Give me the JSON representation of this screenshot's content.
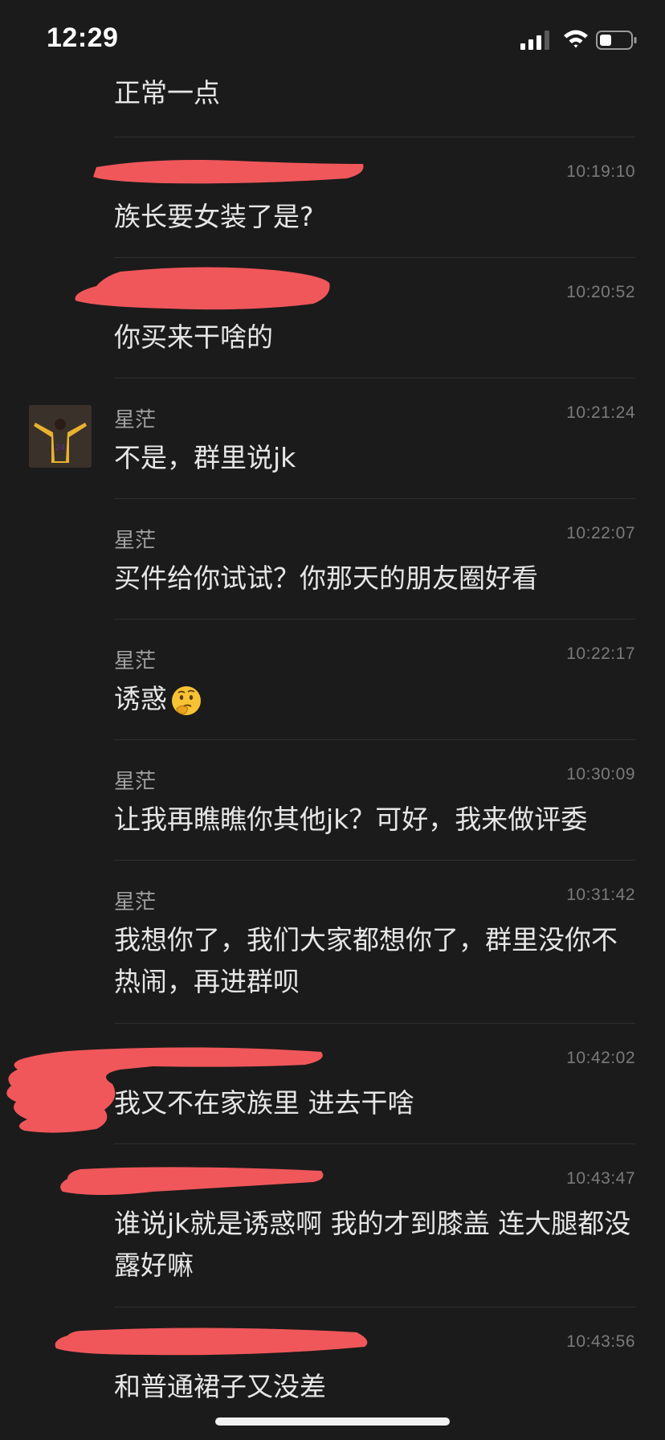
{
  "status_bar": {
    "time": "12:29",
    "signal_icon": "cellular-signal-icon",
    "wifi_icon": "wifi-icon",
    "battery_icon": "battery-icon"
  },
  "messages": [
    {
      "sender": "",
      "time": "",
      "text": "正常一点"
    },
    {
      "sender": "",
      "time": "10:19:10",
      "text": "族长要女装了是?"
    },
    {
      "sender": "",
      "time": "10:20:52",
      "text": "你买来干啥的"
    },
    {
      "sender": "星茫",
      "time": "10:21:24",
      "text": "不是，群里说jk"
    },
    {
      "sender": "星茫",
      "time": "10:22:07",
      "text": "买件给你试试？你那天的朋友圈好看"
    },
    {
      "sender": "星茫",
      "time": "10:22:17",
      "text": "诱惑"
    },
    {
      "sender": "星茫",
      "time": "10:30:09",
      "text": "让我再瞧瞧你其他jk？可好，我来做评委"
    },
    {
      "sender": "星茫",
      "time": "10:31:42",
      "text": "我想你了，我们大家都想你了，群里没你不热闹，再进群呗"
    },
    {
      "sender": "",
      "time": "10:42:02",
      "text": "我又不在家族里 进去干啥"
    },
    {
      "sender": "",
      "time": "10:43:47",
      "text": "谁说jk就是诱惑啊 我的才到膝盖 连大腿都没露好嘛"
    },
    {
      "sender": "",
      "time": "10:43:56",
      "text": "和普通裙子又没差"
    }
  ],
  "colors": {
    "background": "#1b1b1b",
    "redaction": "#f0575a",
    "text": "#e6e6e6",
    "meta": "#7a7a7a"
  }
}
